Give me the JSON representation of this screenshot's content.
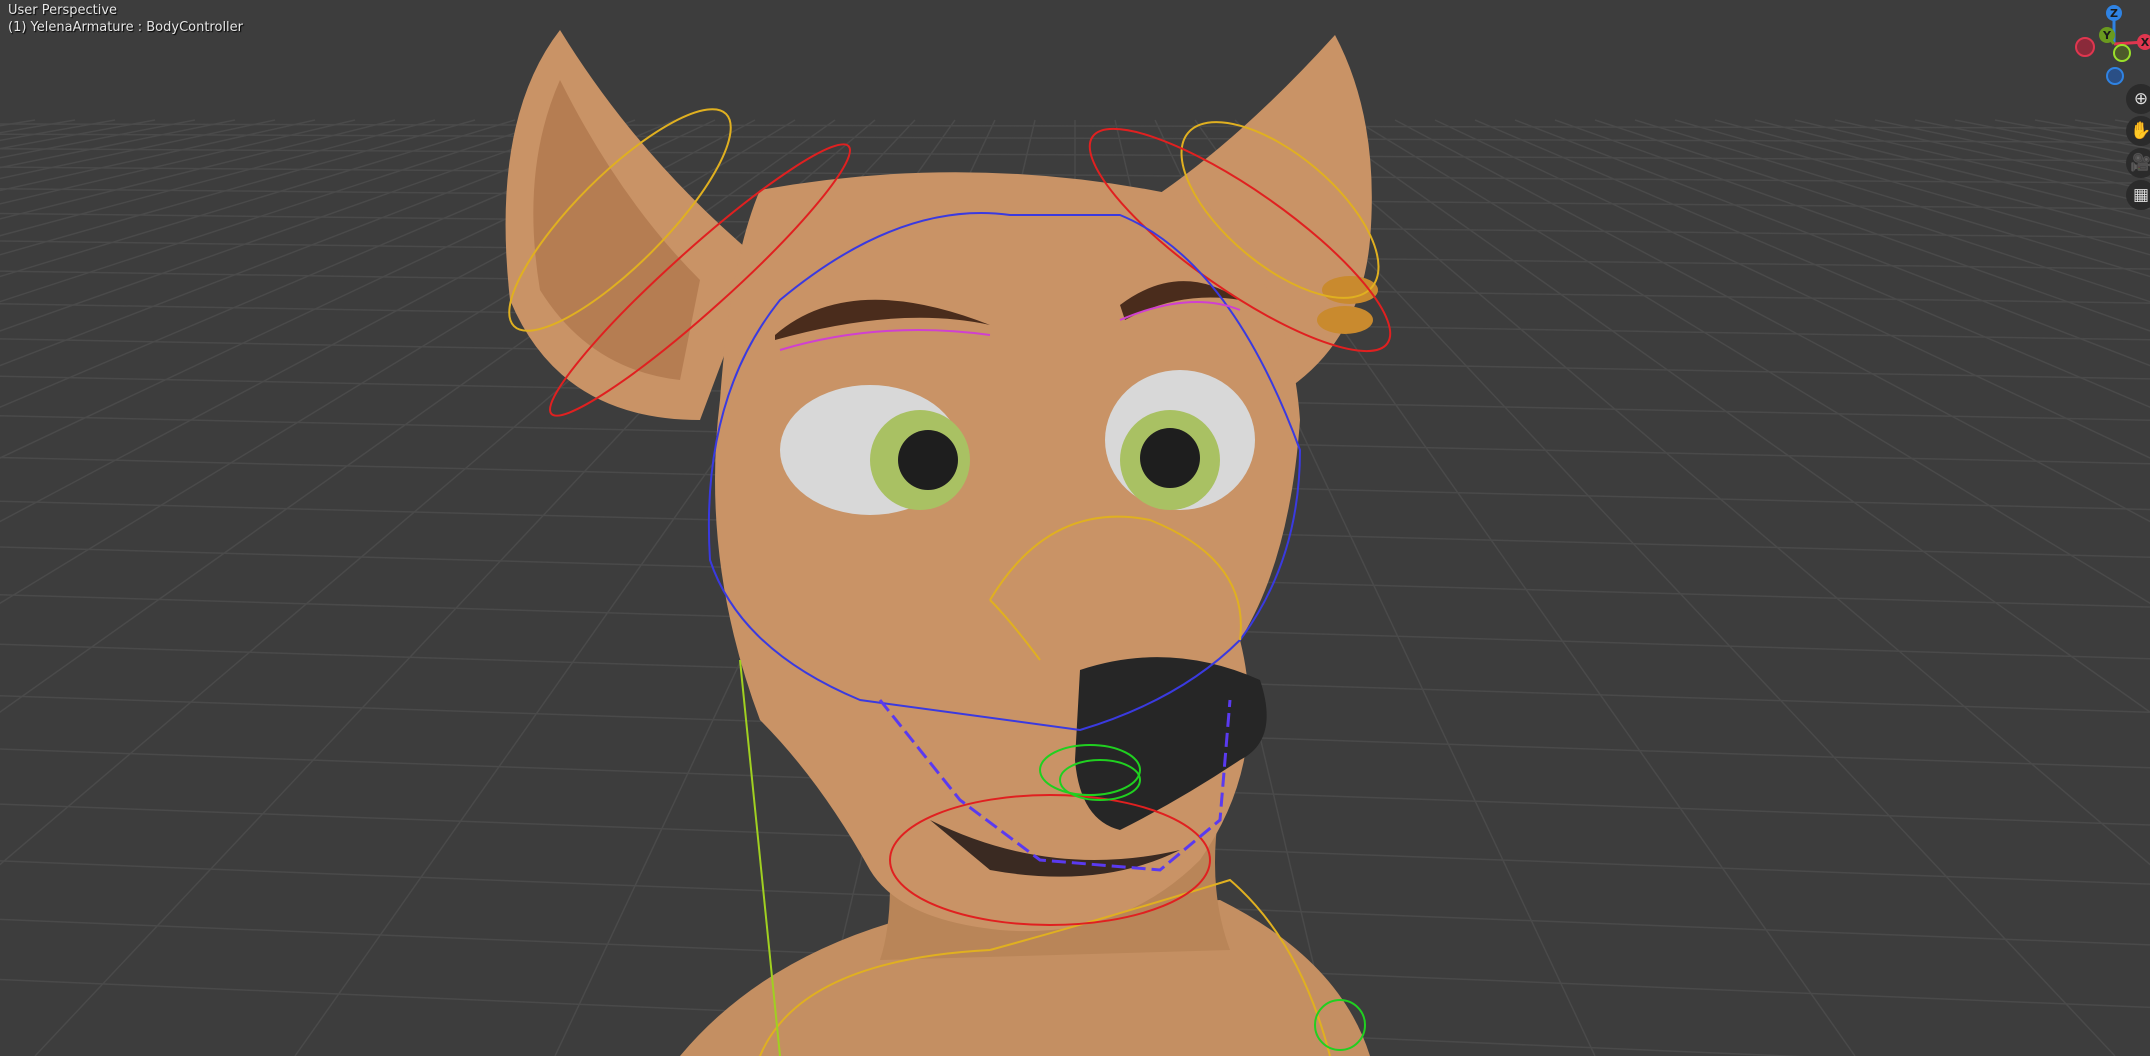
{
  "viewport": {
    "view_name": "User Perspective",
    "active_object": "(1) YelenaArmature : BodyController"
  },
  "gizmo": {
    "x_label": "X",
    "y_label": "Y",
    "z_label": "Z",
    "x_color": "#e0364f",
    "y_color": "#6a9a1f",
    "z_color": "#2f83e3"
  },
  "nav_buttons": [
    {
      "name": "zoom",
      "icon": "zoom-icon"
    },
    {
      "name": "pan",
      "icon": "hand-icon"
    },
    {
      "name": "camera",
      "icon": "camera-icon"
    },
    {
      "name": "perspective-toggle",
      "icon": "grid-icon"
    }
  ]
}
